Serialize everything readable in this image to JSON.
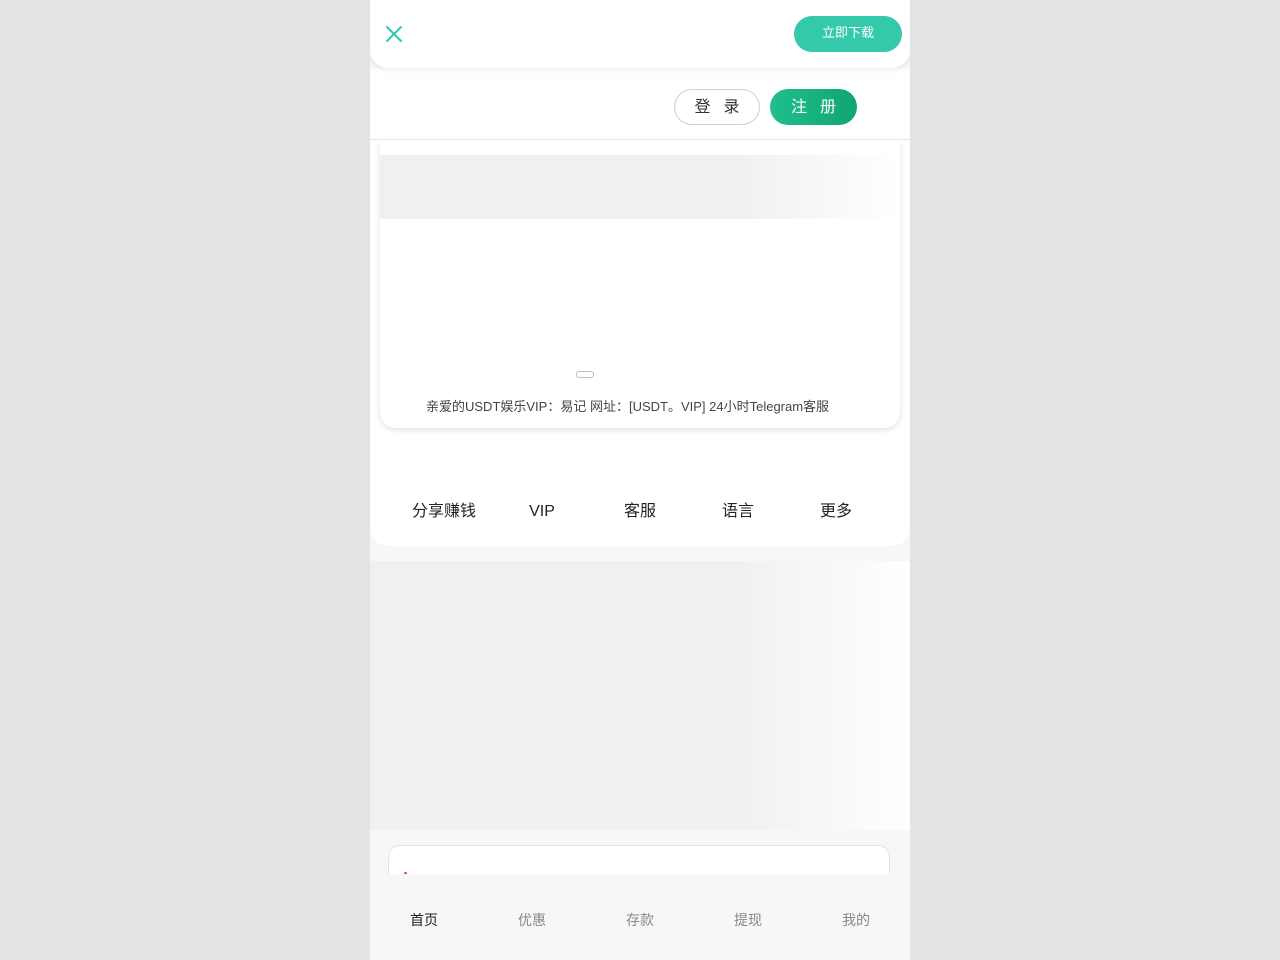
{
  "download_banner": {
    "close_icon": "close-icon",
    "download_label": "立即下载",
    "accent_color": "#35c9ab"
  },
  "header": {
    "login_label": "登 录",
    "register_label": "注 册",
    "register_color": "#1fbf8f"
  },
  "notice": {
    "text": "亲爱的USDT娱乐VIP：易记 网址：[USDT。VIP] 24小时Telegram客服"
  },
  "quick_nav": {
    "items": [
      {
        "label": "分享赚钱"
      },
      {
        "label": "VIP"
      },
      {
        "label": "客服"
      },
      {
        "label": "语言"
      },
      {
        "label": "更多"
      }
    ]
  },
  "section": {
    "title": "..."
  },
  "tabbar": {
    "active_index": 0,
    "tabs": [
      {
        "label": "首页"
      },
      {
        "label": "优惠"
      },
      {
        "label": "存款"
      },
      {
        "label": "提现"
      },
      {
        "label": "我的"
      }
    ]
  }
}
